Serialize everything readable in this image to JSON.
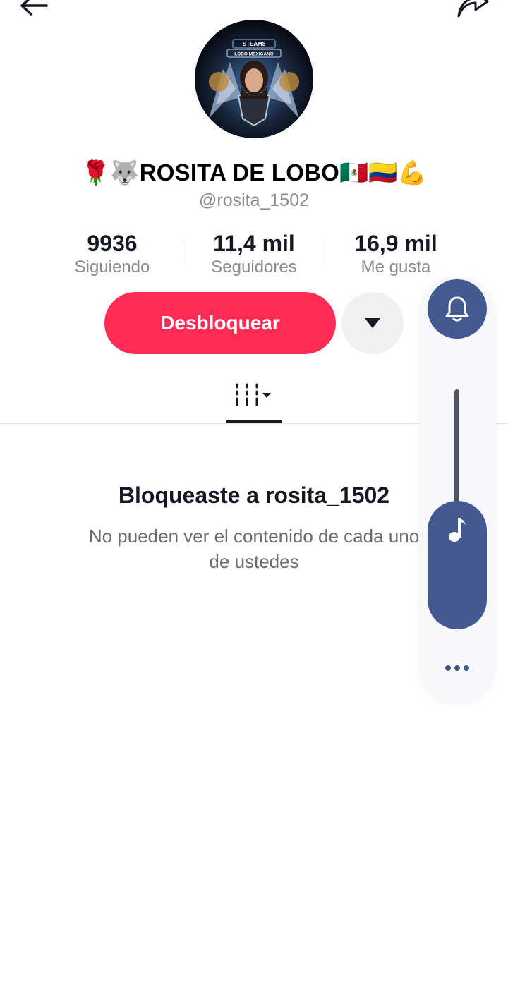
{
  "profile": {
    "display_name": "🌹🐺ROSITA DE LOBO🇲🇽🇨🇴💪",
    "username": "@rosita_1502",
    "avatar_text_top": "STEAM8",
    "avatar_text_banner": "LOBO MEXICANO"
  },
  "stats": {
    "following_count": "9936",
    "following_label": "Siguiendo",
    "followers_count": "11,4 mil",
    "followers_label": "Seguidores",
    "likes_count": "16,9 mil",
    "likes_label": "Me gusta"
  },
  "actions": {
    "unblock_label": "Desbloquear"
  },
  "blocked": {
    "title": "Bloqueaste a rosita_1502",
    "description": "No pueden ver el contenido de cada uno de ustedes"
  },
  "volume_panel": {
    "level": 0.55,
    "accent": "#43598f"
  },
  "colors": {
    "primary": "#fe2c55",
    "text": "#161823",
    "muted": "#8a8b91"
  }
}
